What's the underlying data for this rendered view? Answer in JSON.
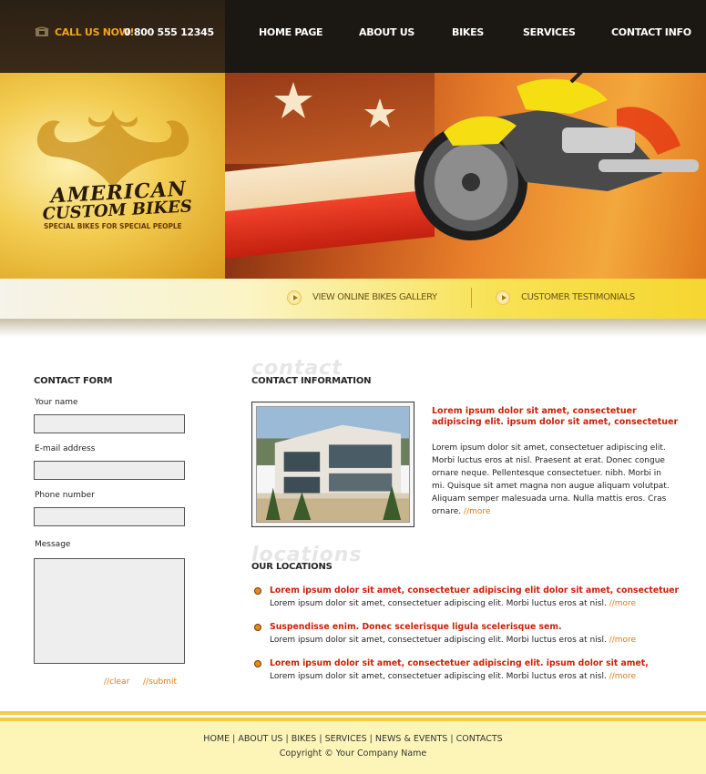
{
  "header": {
    "call_now": "CALL US NOW!",
    "phone": "0 800 555 12345",
    "nav": [
      "HOME PAGE",
      "ABOUT US",
      "BIKES",
      "SERVICES",
      "CONTACT INFO"
    ]
  },
  "logo": {
    "line1": "AMERICAN",
    "line2": "CUSTOM BIKES",
    "tagline": "SPECIAL BIKES FOR SPECIAL PEOPLE"
  },
  "subbar": {
    "gallery_link": "VIEW ONLINE BIKES GALLERY",
    "testimonials_link": "CUSTOMER TESTIMONIALS"
  },
  "contact_form": {
    "title": "CONTACT FORM",
    "name_label": "Your name",
    "email_label": "E-mail address",
    "phone_label": "Phone number",
    "message_label": "Message",
    "clear": "//clear",
    "submit": "//submit"
  },
  "contact_info": {
    "ghost": "contact",
    "title": "CONTACT INFORMATION",
    "red_line1": "Lorem ipsum dolor sit amet, consectetuer",
    "red_line2": "adipiscing elit. ipsum dolor sit amet, consectetuer",
    "body_lines": [
      "Lorem ipsum dolor sit amet, consectetuer adipiscing elit.",
      "Morbi luctus eros at nisl. Praesent at erat. Donec congue",
      "ornare neque. Pellentesque consectetuer. nibh. Morbi in",
      "mi. Quisque sit amet magna non augue aliquam volutpat.",
      "Aliquam semper malesuada urna. Nulla mattis eros. Cras"
    ],
    "last_line": "ornare.",
    "more": "//more"
  },
  "locations": {
    "ghost": "locations",
    "title": "OUR LOCATIONS",
    "items": [
      {
        "heading": "Lorem ipsum dolor sit amet, consectetuer adipiscing elit dolor sit amet, consectetuer",
        "text": "Lorem ipsum dolor sit amet, consectetuer adipiscing elit. Morbi luctus eros at nisl.",
        "more": "//more"
      },
      {
        "heading": "Suspendisse enim. Donec scelerisque ligula scelerisque sem.",
        "text": "Lorem ipsum dolor sit amet, consectetuer adipiscing elit. Morbi luctus eros at nisl.",
        "more": "//more"
      },
      {
        "heading": "Lorem ipsum dolor sit amet, consectetuer adipiscing elit. ipsum dolor sit amet,",
        "text": "Lorem ipsum dolor sit amet, consectetuer adipiscing elit. Morbi luctus eros at nisl.",
        "more": "//more"
      }
    ]
  },
  "footer": {
    "links": [
      "HOME",
      "ABOUT US",
      "BIKES",
      "SERVICES",
      "NEWS & EVENTS",
      "CONTACTS"
    ],
    "copyright": "Copyright © Your Company Name"
  },
  "icons": {
    "phone": "phone-icon",
    "play": "play-circle-icon",
    "bullet": "bullet-icon"
  },
  "colors": {
    "accent_orange": "#f0a51a",
    "link_orange": "#e07a10",
    "red_heading": "#cc1f06",
    "header_dark": "#1b1712",
    "footer_yellow": "#fdf5b8"
  }
}
